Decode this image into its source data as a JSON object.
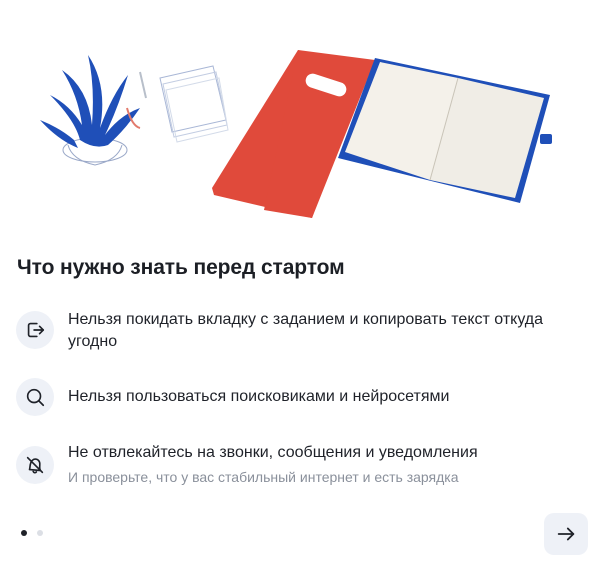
{
  "intro": {
    "title": "Что нужно знать перед стартом",
    "rules": [
      {
        "icon": "exit-icon",
        "text": "Нельзя покидать вкладку с заданием и копировать текст откуда угодно"
      },
      {
        "icon": "search-icon",
        "text": "Нельзя пользоваться поисковиками и нейросетями"
      },
      {
        "icon": "bell-off-icon",
        "text": "Не отвлекайтесь на звонки, сообщения и уведомления",
        "sub": "И проверьте, что у вас стабильный интернет и есть зарядка"
      }
    ]
  },
  "pager": {
    "current": 1,
    "total": 2
  },
  "next_button": {
    "icon": "arrow-right-icon"
  },
  "colors": {
    "accent_red": "#e04a3b",
    "accent_blue": "#1f4fb8",
    "icon_bg": "#eef1f7",
    "muted_text": "#8a909b"
  }
}
